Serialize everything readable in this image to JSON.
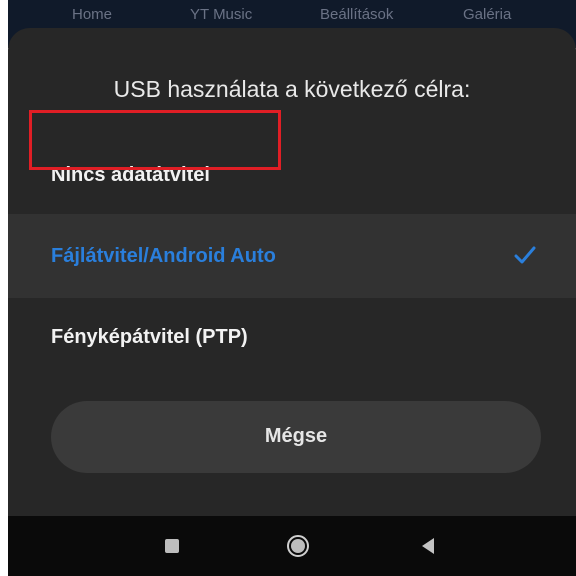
{
  "app_bar": {
    "tabs": [
      "Home",
      "YT Music",
      "Beállítások",
      "Galéria"
    ]
  },
  "sheet": {
    "title": "USB használata a következő célra:",
    "options": [
      {
        "label": "Nincs adatátvitel",
        "selected": false,
        "highlighted_by_annotation": true
      },
      {
        "label": "Fájlátvitel/Android Auto",
        "selected": true
      },
      {
        "label": "Fényképátvitel (PTP)",
        "selected": false
      }
    ],
    "cancel_label": "Mégse"
  },
  "icons": {
    "selected_mark": "check-icon",
    "nav": [
      "recents-icon",
      "home-icon",
      "back-icon"
    ]
  },
  "colors": {
    "sheet_background": "#272727",
    "selected_row": "#323232",
    "accent_blue": "#2a7fdc",
    "annotation_red": "#e01e25",
    "nav_background": "#0a0a0a"
  }
}
